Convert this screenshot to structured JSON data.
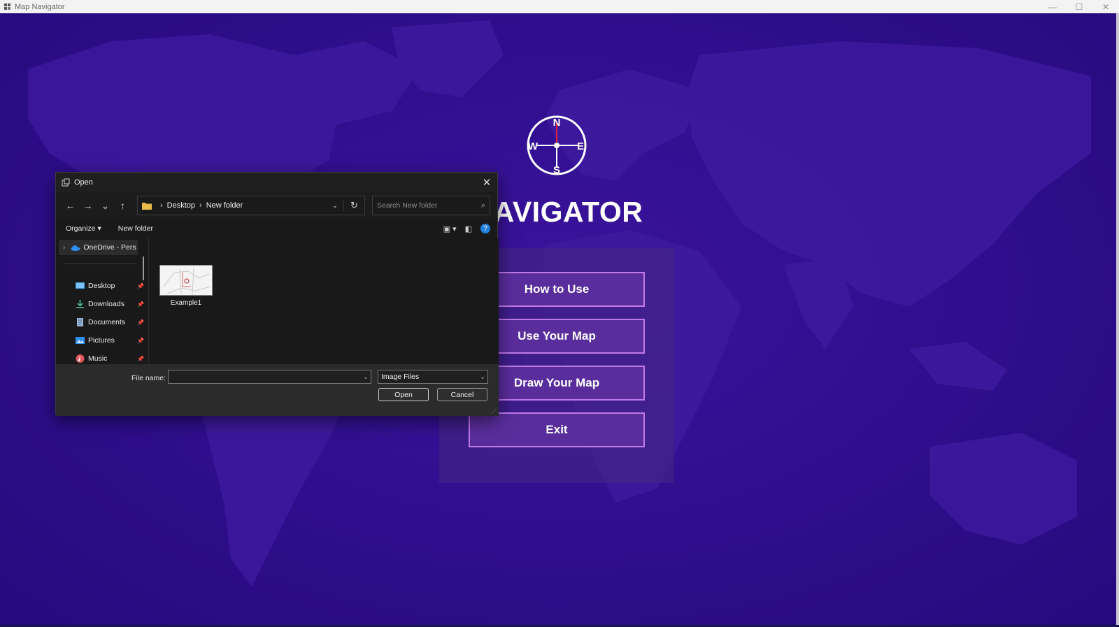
{
  "window": {
    "title": "Map Navigator",
    "controls": {
      "minimize": "—",
      "maximize": "☐",
      "close": "✕"
    }
  },
  "app": {
    "compass_letters": {
      "n": "N",
      "s": "S",
      "e": "E",
      "w": "W"
    },
    "title_visible": "NAVIGATOR",
    "menu": {
      "how_to_use": "How to Use",
      "use_your_map": "Use Your Map",
      "draw_your_map": "Draw Your Map",
      "exit": "Exit"
    }
  },
  "dialog": {
    "title": "Open",
    "nav": {
      "back": "←",
      "forward": "→",
      "recent": "⌄",
      "up": "↑"
    },
    "address": {
      "crumbs": [
        "Desktop",
        "New folder"
      ],
      "separator": "›"
    },
    "search": {
      "placeholder": "Search New folder"
    },
    "command_bar": {
      "organize": "Organize ▾",
      "new_folder": "New folder",
      "help": "?"
    },
    "nav_pane": {
      "onedrive": "OneDrive - Pers",
      "quick_access": [
        {
          "label": "Desktop",
          "icon": "desktop-icon"
        },
        {
          "label": "Downloads",
          "icon": "download-icon"
        },
        {
          "label": "Documents",
          "icon": "documents-icon"
        },
        {
          "label": "Pictures",
          "icon": "pictures-icon"
        },
        {
          "label": "Music",
          "icon": "music-icon"
        }
      ]
    },
    "files": [
      {
        "name": "Example1"
      }
    ],
    "footer": {
      "file_name_label": "File name:",
      "file_name_value": "",
      "file_type": "Image Files",
      "open_label": "Open",
      "cancel_label": "Cancel"
    }
  },
  "colors": {
    "background": "#2b0d86",
    "menu_button": "#5a2d9c",
    "menu_button_border": "#c07ae8",
    "compass_needle": "#e0203a",
    "dialog_bg": "#202020"
  }
}
